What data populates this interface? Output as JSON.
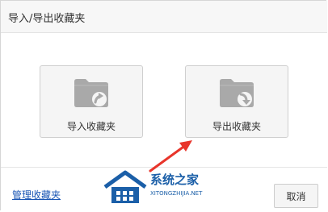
{
  "dialog": {
    "title": "导入/导出收藏夹"
  },
  "actions": [
    {
      "label": "导入收藏夹",
      "icon": "folder-import-icon"
    },
    {
      "label": "导出收藏夹",
      "icon": "folder-export-icon"
    }
  ],
  "footer": {
    "manage_link": "管理收藏夹",
    "cancel_label": "取消"
  },
  "watermark": {
    "brand": "系统之家",
    "site": "XITONGZHIJIA.NET"
  },
  "colors": {
    "title_bar": "#f7f7f7",
    "card_bg": "#f5f5f5",
    "folder_gray": "#a9a9a9",
    "link_blue": "#1a56b4",
    "annotation_red": "#e8352b",
    "watermark_blue": "#1b5fa8"
  }
}
